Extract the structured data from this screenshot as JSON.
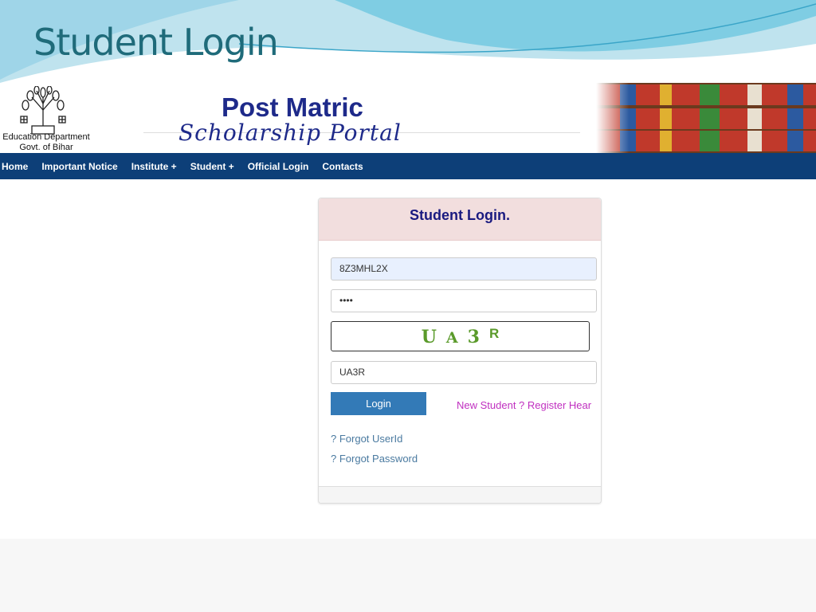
{
  "slide": {
    "title": "Student Login"
  },
  "header": {
    "dept_line1": "Education Department",
    "dept_line2": "Govt. of Bihar",
    "brand_line1": "Post Matric",
    "brand_line2": "Scholarship Portal"
  },
  "nav": {
    "items": [
      {
        "label": "Home"
      },
      {
        "label": "Important Notice"
      },
      {
        "label": "Institute +"
      },
      {
        "label": "Student +"
      },
      {
        "label": "Official Login"
      },
      {
        "label": "Contacts"
      }
    ]
  },
  "login": {
    "title": "Student Login.",
    "userid_value": "8Z3MHL2X",
    "password_value": "••••",
    "captcha_chars": [
      "U",
      "A",
      "3",
      "R"
    ],
    "captcha_input_value": "UA3R",
    "login_label": "Login",
    "register_link": "New Student ? Register Hear",
    "forgot_userid": "? Forgot UserId",
    "forgot_password": "? Forgot Password"
  },
  "colors": {
    "nav_bg": "#0d3f78",
    "panel_head_bg": "#f2dede",
    "button_bg": "#337ab7",
    "register_link": "#c030c0",
    "captcha_text": "#5a9a2a"
  }
}
